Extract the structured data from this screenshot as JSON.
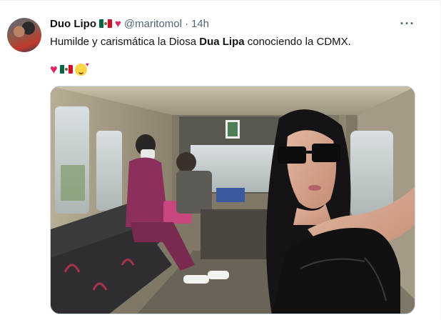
{
  "tweet": {
    "display_name": "Duo Lipo",
    "handle": "@maritomol",
    "separator": "·",
    "time": "14h",
    "more_label": "···",
    "text_before": "Humilde y carismática la Diosa ",
    "text_bold": "Dua Lipa",
    "text_after": " conociendo la CDMX.",
    "header_emojis": [
      "mexico-flag",
      "red-heart"
    ],
    "emoji_line": [
      "red-heart",
      "mexico-flag",
      "smiling-face-with-hearts"
    ]
  },
  "colors": {
    "text_primary": "#0f1419",
    "text_secondary": "#536471",
    "heart": "#e0245e",
    "border": "#eff3f4"
  }
}
